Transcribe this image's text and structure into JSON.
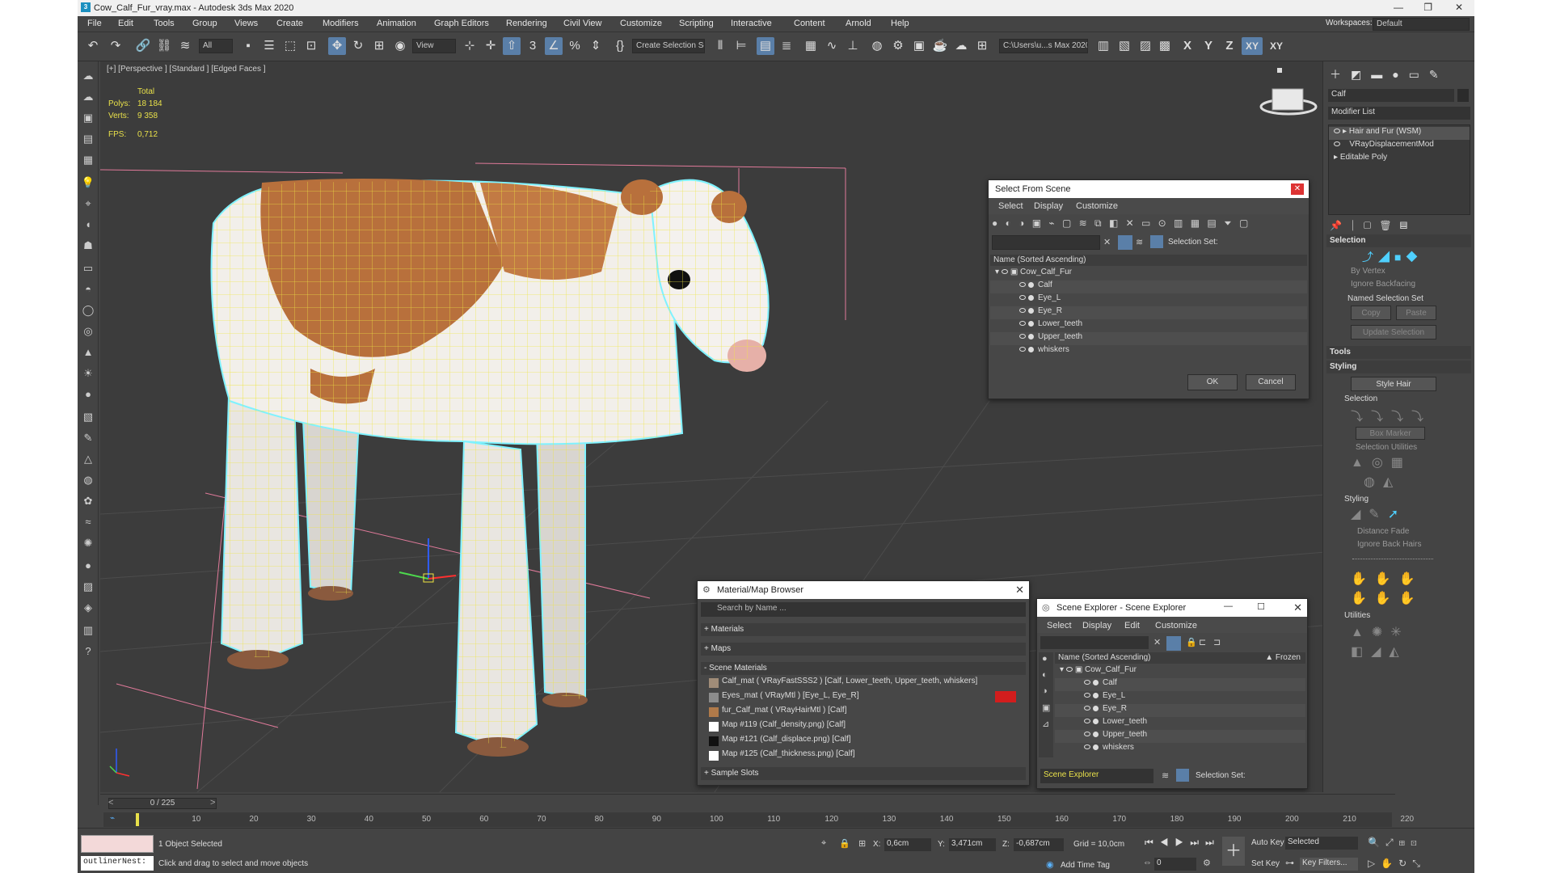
{
  "window": {
    "title": "Cow_Calf_Fur_vray.max - Autodesk 3ds Max 2020"
  },
  "workspace": {
    "label": "Workspaces:",
    "value": "Default"
  },
  "menu": [
    "File",
    "Edit",
    "Tools",
    "Group",
    "Views",
    "Create",
    "Modifiers",
    "Animation",
    "Graph Editors",
    "Rendering",
    "Civil View",
    "Customize",
    "Scripting",
    "Interactive",
    "Content",
    "Arnold",
    "Help"
  ],
  "toolbar": {
    "filter": "All",
    "view": "View",
    "selection_set": "Create Selection Se",
    "path": "C:\\Users\\u...s Max 2020",
    "axis": [
      "X",
      "Y",
      "Z",
      "XY",
      "XY"
    ]
  },
  "viewport": {
    "label": "[+] [Perspective ] [Standard ] [Edged Faces ]",
    "total_label": "Total",
    "polys_label": "Polys:",
    "polys": "18 184",
    "verts_label": "Verts:",
    "verts": "9 358",
    "fps_label": "FPS:",
    "fps": "0,712"
  },
  "select_from_scene": {
    "title": "Select From Scene",
    "menu": [
      "Select",
      "Display",
      "Customize"
    ],
    "selection_set_label": "Selection Set:",
    "column": "Name (Sorted Ascending)",
    "root": "Cow_Calf_Fur",
    "items": [
      "Calf",
      "Eye_L",
      "Eye_R",
      "Lower_teeth",
      "Upper_teeth",
      "whiskers"
    ],
    "ok": "OK",
    "cancel": "Cancel"
  },
  "material_browser": {
    "title": "Material/Map Browser",
    "search": "Search by Name ...",
    "groups": [
      "+ Materials",
      "+ Maps",
      "- Scene Materials",
      "+ Sample Slots"
    ],
    "materials": [
      "Calf_mat  ( VRayFastSSS2 ) [Calf, Lower_teeth, Upper_teeth, whiskers]",
      "Eyes_mat  ( VRayMtl ) [Eye_L, Eye_R]",
      "fur_Calf_mat  ( VRayHairMtl ) [Calf]",
      "Map #119 (Calf_density.png)  [Calf]",
      "Map #121 (Calf_displace.png)  [Calf]",
      "Map #125 (Calf_thickness.png)  [Calf]"
    ]
  },
  "scene_explorer": {
    "title": "Scene Explorer - Scene Explorer",
    "menu": [
      "Select",
      "Display",
      "Edit",
      "Customize"
    ],
    "column": "Name (Sorted Ascending)",
    "frozen": "▲ Frozen",
    "root": "Cow_Calf_Fur",
    "items": [
      "Calf",
      "Eye_L",
      "Eye_R",
      "Lower_teeth",
      "Upper_teeth",
      "whiskers"
    ],
    "footer_name": "Scene Explorer",
    "selection_set_label": "Selection Set:"
  },
  "command_panel": {
    "object_name": "Calf",
    "modifier_list": "Modifier List",
    "stack": [
      "Hair and Fur (WSM)",
      "VRayDisplacementMod",
      "Editable Poly"
    ],
    "selection": "Selection",
    "by_vertex": "By Vertex",
    "ignore_backfacing": "Ignore Backfacing",
    "named_selection_set": "Named Selection Set",
    "copy": "Copy",
    "paste": "Paste",
    "update_selection": "Update Selection",
    "tools": "Tools",
    "styling": "Styling",
    "style_hair": "Style Hair",
    "sub_selection": "Selection",
    "box_marker": "Box Marker",
    "selection_utilities": "Selection Utilities",
    "sub_styling": "Styling",
    "distance_fade": "Distance Fade",
    "ignore_back_hairs": "Ignore Back Hairs",
    "utilities": "Utilities"
  },
  "timeline": {
    "frame": "0 / 225",
    "ticks": [
      "0",
      "10",
      "20",
      "30",
      "40",
      "50",
      "60",
      "70",
      "80",
      "90",
      "100",
      "110",
      "120",
      "130",
      "140",
      "150",
      "160",
      "170",
      "180",
      "190",
      "200",
      "210",
      "220"
    ]
  },
  "status": {
    "script": "outlinerNest:",
    "selected": "1 Object Selected",
    "hint": "Click and drag to select and move objects",
    "x_label": "X:",
    "x": "0,6cm",
    "y_label": "Y:",
    "y": "3,471cm",
    "z_label": "Z:",
    "z": "-0,687cm",
    "grid": "Grid = 10,0cm",
    "add_time_tag": "Add Time Tag",
    "auto_key": "Auto Key",
    "auto_key_mode": "Selected",
    "set_key": "Set Key",
    "key_filters": "Key Filters...",
    "frame_value": "0"
  },
  "colors": {
    "wire": "#f0e641",
    "outline": "#7ff2ff",
    "accent": "#5a7fa8"
  }
}
